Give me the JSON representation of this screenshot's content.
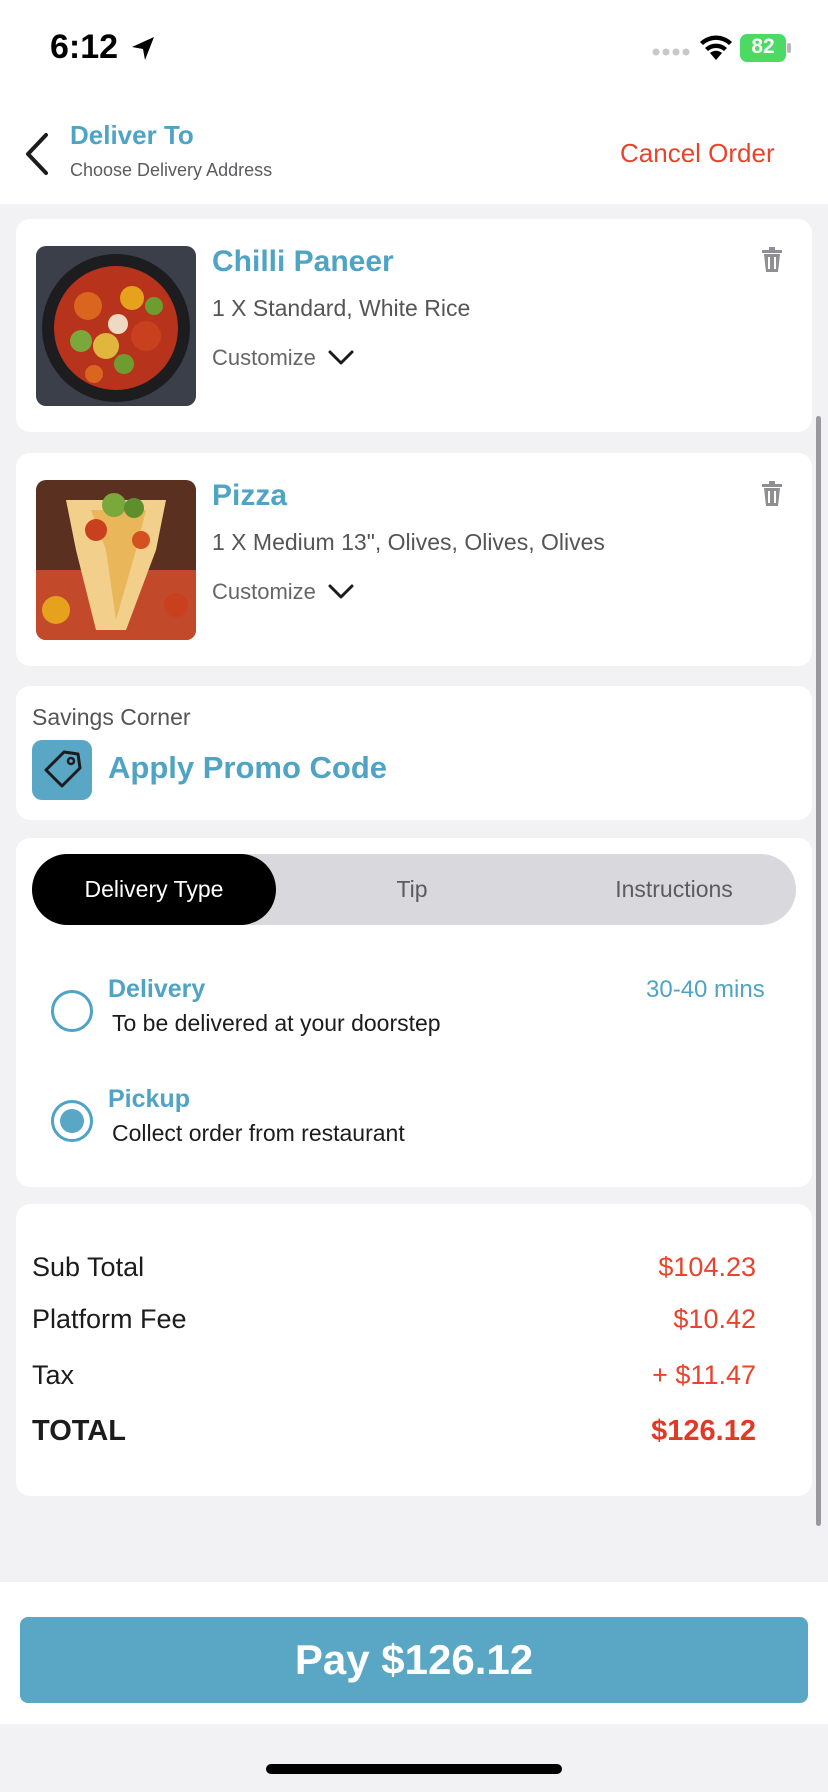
{
  "status_bar": {
    "time": "6:12",
    "battery": "82"
  },
  "header": {
    "title": "Deliver To",
    "subtitle": "Choose Delivery Address",
    "cancel_label": "Cancel Order"
  },
  "cart_items": [
    {
      "name": "Chilli Paneer",
      "details": "1 X Standard, White Rice",
      "customize_label": "Customize"
    },
    {
      "name": "Pizza",
      "details": "1 X Medium 13\", Olives, Olives, Olives",
      "customize_label": "Customize"
    }
  ],
  "savings": {
    "label": "Savings Corner",
    "promo_label": "Apply Promo Code"
  },
  "tabs": [
    {
      "label": "Delivery Type",
      "active": true
    },
    {
      "label": "Tip",
      "active": false
    },
    {
      "label": "Instructions",
      "active": false
    }
  ],
  "delivery_options": [
    {
      "title": "Delivery",
      "subtitle": "To be delivered at your doorstep",
      "eta": "30-40 mins",
      "selected": false
    },
    {
      "title": "Pickup",
      "subtitle": "Collect order from restaurant",
      "eta": "",
      "selected": true
    }
  ],
  "summary": {
    "subtotal_label": "Sub Total",
    "subtotal": "$104.23",
    "fee_label": "Platform Fee",
    "fee": "$10.42",
    "tax_label": "Tax",
    "tax": "+ $11.47",
    "total_label": "TOTAL",
    "total": "$126.12"
  },
  "pay_button": "Pay $126.12",
  "colors": {
    "accent": "#4fa3c4",
    "danger": "#e8442c",
    "battery": "#4cd964"
  }
}
